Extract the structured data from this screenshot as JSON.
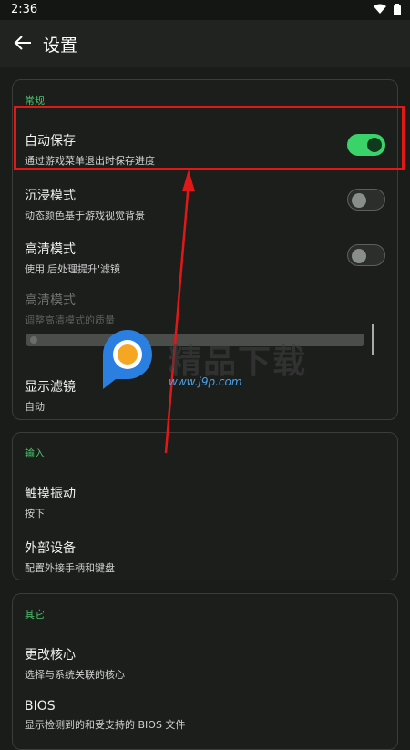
{
  "status": {
    "time": "2:36"
  },
  "header": {
    "title": "设置"
  },
  "sections": [
    {
      "title": "常规",
      "items": [
        {
          "title": "自动保存",
          "subtitle": "通过游戏菜单退出时保存进度",
          "toggle": true
        },
        {
          "title": "沉浸模式",
          "subtitle": "动态颜色基于游戏视觉背景",
          "toggle": false
        },
        {
          "title": "高清模式",
          "subtitle": "使用'后处理提升'滤镜",
          "toggle": false
        },
        {
          "title": "高清模式",
          "subtitle": "调整高清模式的质量",
          "disabled": true
        },
        {
          "title": "显示滤镜",
          "subtitle": "自动"
        }
      ]
    },
    {
      "title": "输入",
      "items": [
        {
          "title": "触摸振动",
          "subtitle": "按下"
        },
        {
          "title": "外部设备",
          "subtitle": "配置外接手柄和键盘"
        }
      ]
    },
    {
      "title": "其它",
      "items": [
        {
          "title": "更改核心",
          "subtitle": "选择与系统关联的核心"
        },
        {
          "title": "BIOS",
          "subtitle": "显示检测到的和受支持的 BIOS 文件"
        }
      ]
    }
  ],
  "watermark": {
    "text": "精品下载",
    "url": "www.j9p.com"
  },
  "colors": {
    "accent": "#4cc36a",
    "switch_on": "#3ad36a",
    "annotation": "#e01818"
  }
}
